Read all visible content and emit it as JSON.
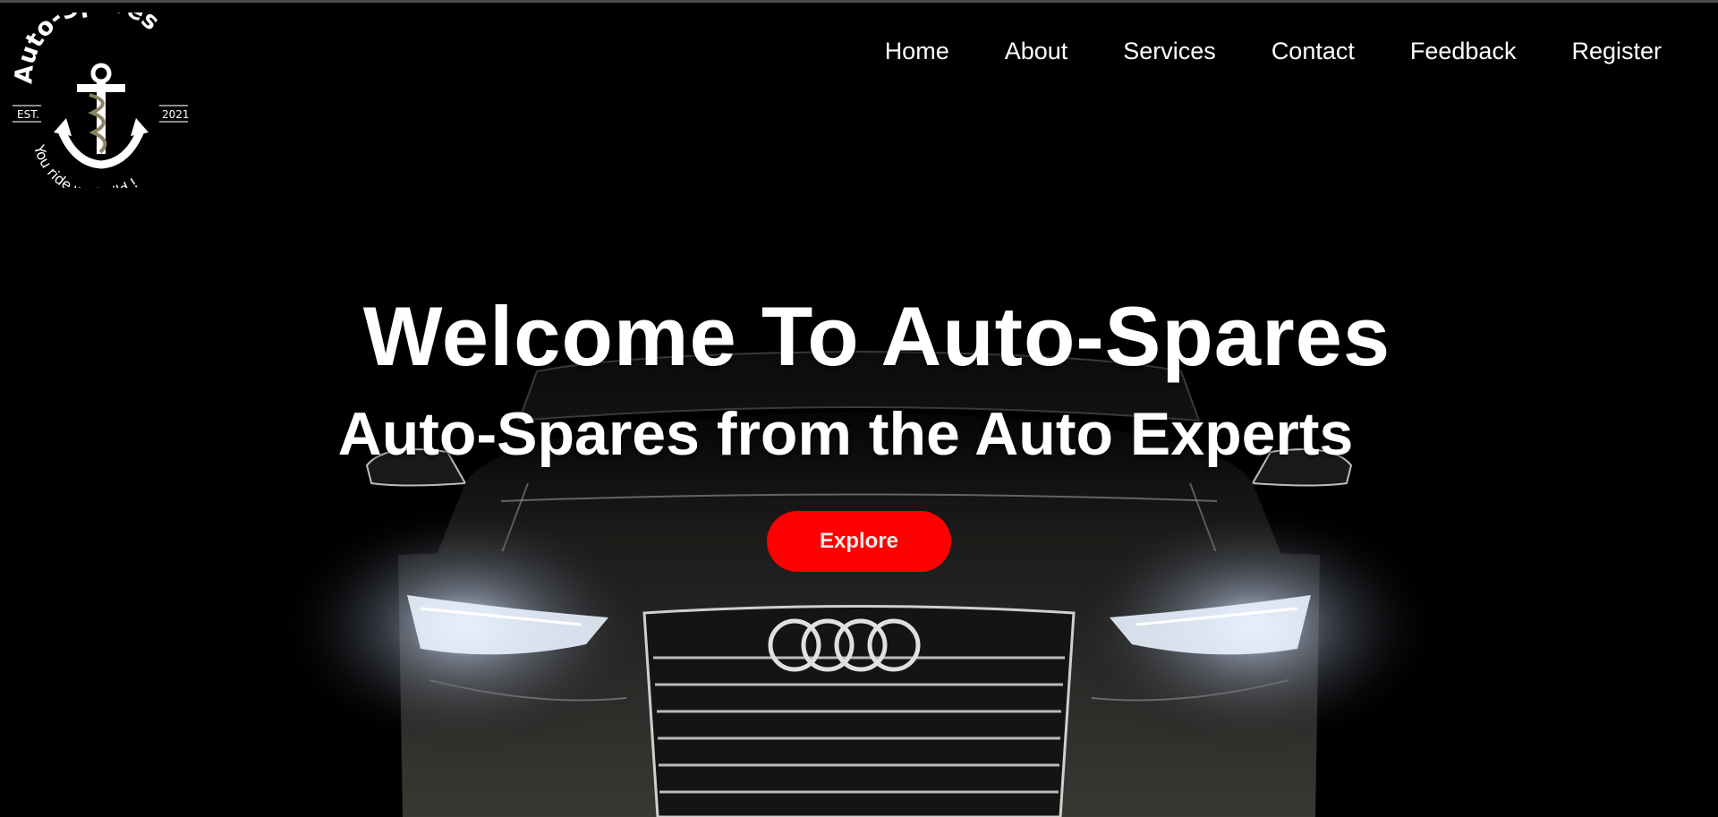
{
  "logo": {
    "brand": "Auto-Spares",
    "est_left": "EST.",
    "est_right": "2021",
    "tagline": "You ride we build.!"
  },
  "nav": {
    "items": [
      {
        "label": "Home"
      },
      {
        "label": "About"
      },
      {
        "label": "Services"
      },
      {
        "label": "Contact"
      },
      {
        "label": "Feedback"
      },
      {
        "label": "Register"
      }
    ]
  },
  "hero": {
    "title": "Welcome To Auto-Spares",
    "subtitle": "Auto-Spares from the Auto Experts",
    "cta_label": "Explore",
    "background_icon": "car-front-image"
  },
  "colors": {
    "background": "#000000",
    "cta": "#ff0000",
    "text": "#ffffff"
  }
}
